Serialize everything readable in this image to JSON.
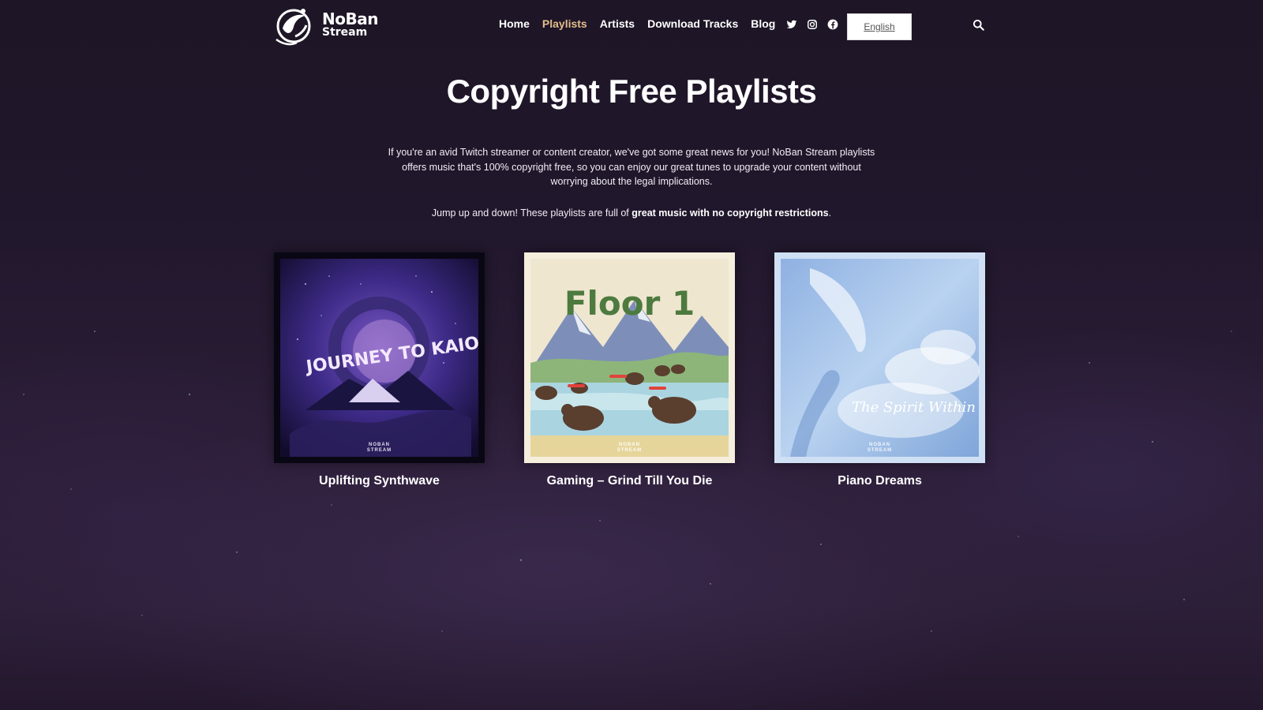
{
  "header": {
    "logo": {
      "line1": "NoBan",
      "line2": "Stream"
    },
    "nav": [
      {
        "label": "Home",
        "active": false
      },
      {
        "label": "Playlists",
        "active": true
      },
      {
        "label": "Artists",
        "active": false
      },
      {
        "label": "Download Tracks",
        "active": false
      },
      {
        "label": "Blog",
        "active": false
      }
    ],
    "social_icons": [
      "twitter-icon",
      "instagram-icon",
      "facebook-icon"
    ],
    "language": "English",
    "search_icon": "search-icon"
  },
  "main": {
    "title": "Copyright Free Playlists",
    "intro": "If you're an avid Twitch streamer or content creator, we've got some great news for you! NoBan Stream playlists offers music that's 100% copyright free, so you can enjoy our great tunes to upgrade your content without worrying about the legal implications.",
    "intro2_prefix": "Jump up and down! These playlists are full of ",
    "intro2_bold": "great music with no copyright restrictions",
    "intro2_suffix": ".",
    "playlists": [
      {
        "name": "Uplifting Synthwave",
        "cover_text": "JOURNEY TO KAIO",
        "cover_brand_1": "NOBAN",
        "cover_brand_2": "STREAM"
      },
      {
        "name": "Gaming – Grind Till You Die",
        "cover_text": "Floor 1",
        "cover_brand_1": "NOBAN",
        "cover_brand_2": "STREAM"
      },
      {
        "name": "Piano Dreams",
        "cover_text": "The Spirit Within",
        "cover_brand_1": "NOBAN",
        "cover_brand_2": "STREAM"
      }
    ]
  },
  "colors": {
    "background": "#21172c",
    "nav_active": "#e4bd8b",
    "text": "#ffffff"
  }
}
